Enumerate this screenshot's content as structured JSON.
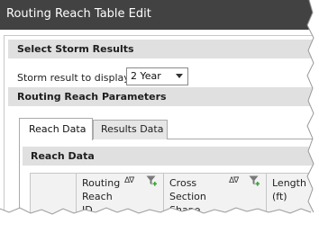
{
  "window": {
    "title": "Routing Reach Table Edit"
  },
  "storm_section": {
    "header": "Select Storm Results",
    "label": "Storm result to display:",
    "selected": "2 Year"
  },
  "params_section": {
    "header": "Routing Reach Parameters"
  },
  "tabs": [
    {
      "label": "Reach Data",
      "active": true
    },
    {
      "label": "Results Data",
      "active": false
    }
  ],
  "reach_data": {
    "header": "Reach Data",
    "columns": [
      {
        "label": "Routing Reach ID"
      },
      {
        "label": "Cross Section Shape"
      },
      {
        "label": "Length (ft)"
      }
    ]
  },
  "colors": {
    "titlebar": "#424242",
    "section_header": "#e0e0e0",
    "filter_plus": "#3aa63a"
  }
}
